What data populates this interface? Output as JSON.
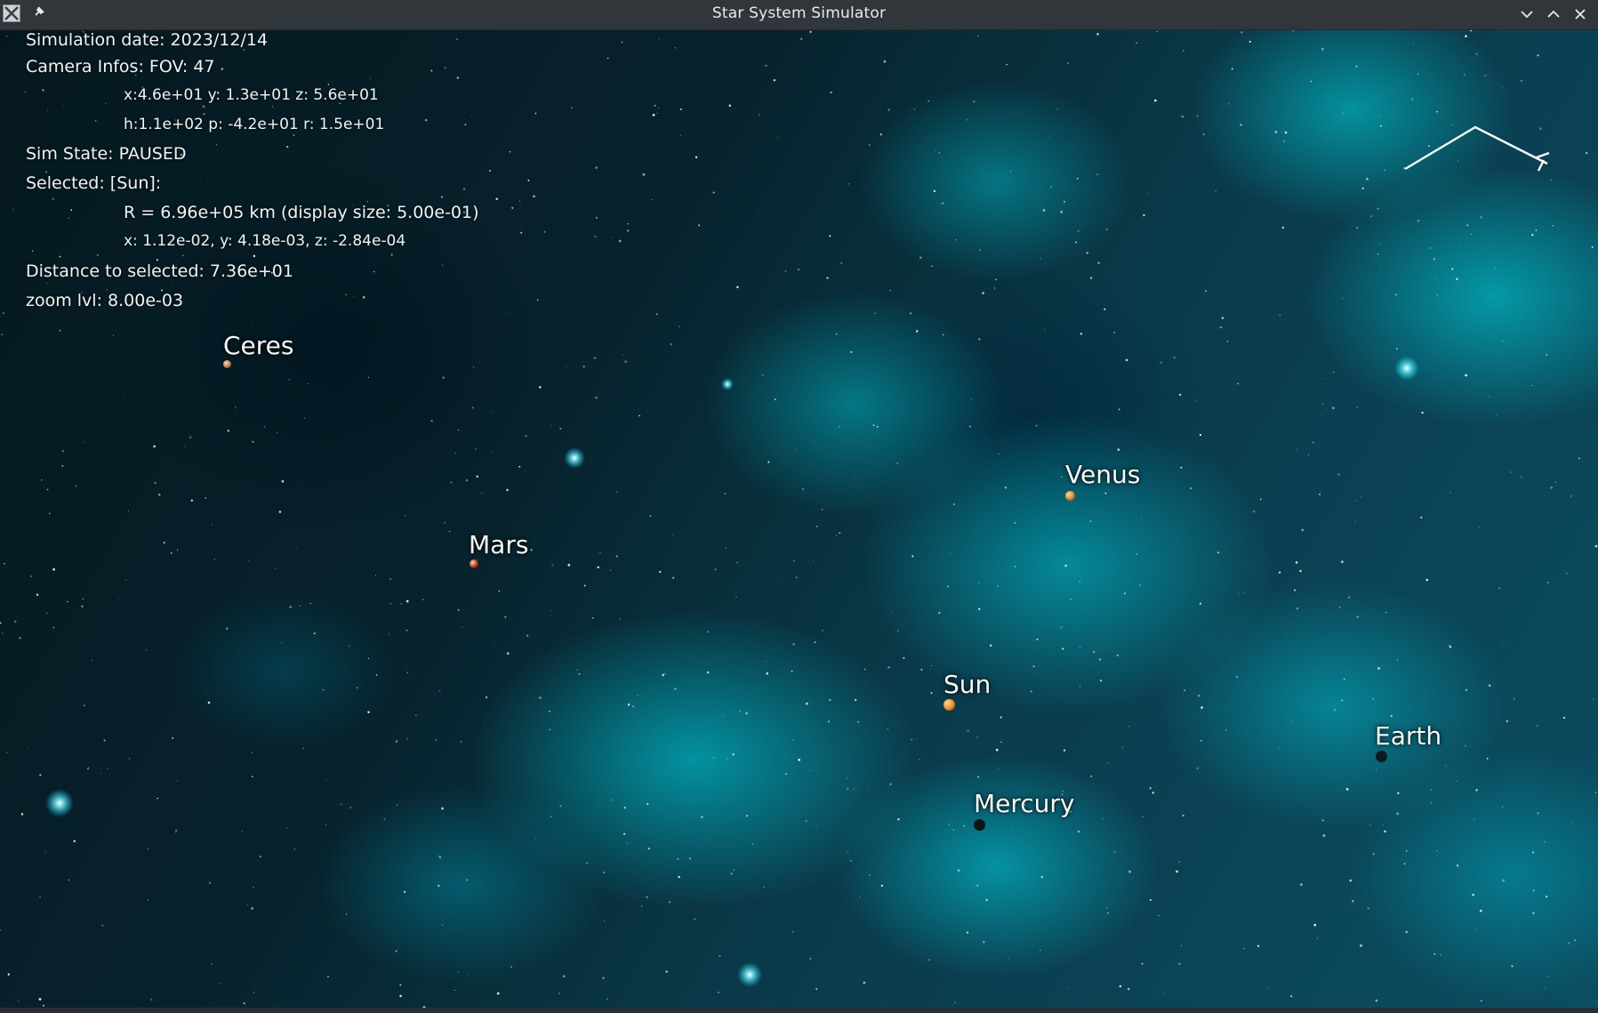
{
  "window": {
    "title": "Star System Simulator",
    "icons": [
      "app-icon",
      "pin-icon",
      "minimize-icon",
      "maximize-icon",
      "close-icon"
    ]
  },
  "hud": {
    "sim_date": "Simulation date: 2023/12/14",
    "camera_fov": "Camera Infos: FOV: 47",
    "camera_pos": "x:4.6e+01 y: 1.3e+01 z: 5.6e+01",
    "camera_rot": "h:1.1e+02 p: -4.2e+01 r: 1.5e+01",
    "sim_state": "Sim State: PAUSED",
    "selected": "Selected: [Sun]:",
    "selected_radius": "R = 6.96e+05 km (display size: 5.00e-01)",
    "selected_pos": "x: 1.12e-02, y: 4.18e-03, z: -2.84e-04",
    "distance": "Distance to selected: 7.36e+01",
    "zoom": "zoom lvl: 8.00e-03"
  },
  "bodies": [
    {
      "name": "Ceres",
      "color": "#c07a4a"
    },
    {
      "name": "Mars",
      "color": "#b3331d"
    },
    {
      "name": "Venus",
      "color": "#d9822b"
    },
    {
      "name": "Sun",
      "color": "#f28a1a"
    },
    {
      "name": "Earth",
      "color": "#0e1a1e"
    },
    {
      "name": "Mercury",
      "color": "#0d1416"
    }
  ],
  "colors": {
    "titlebar": "#31363b",
    "hud_text": "#f2f4f4",
    "nebula": "#00e0f0"
  }
}
